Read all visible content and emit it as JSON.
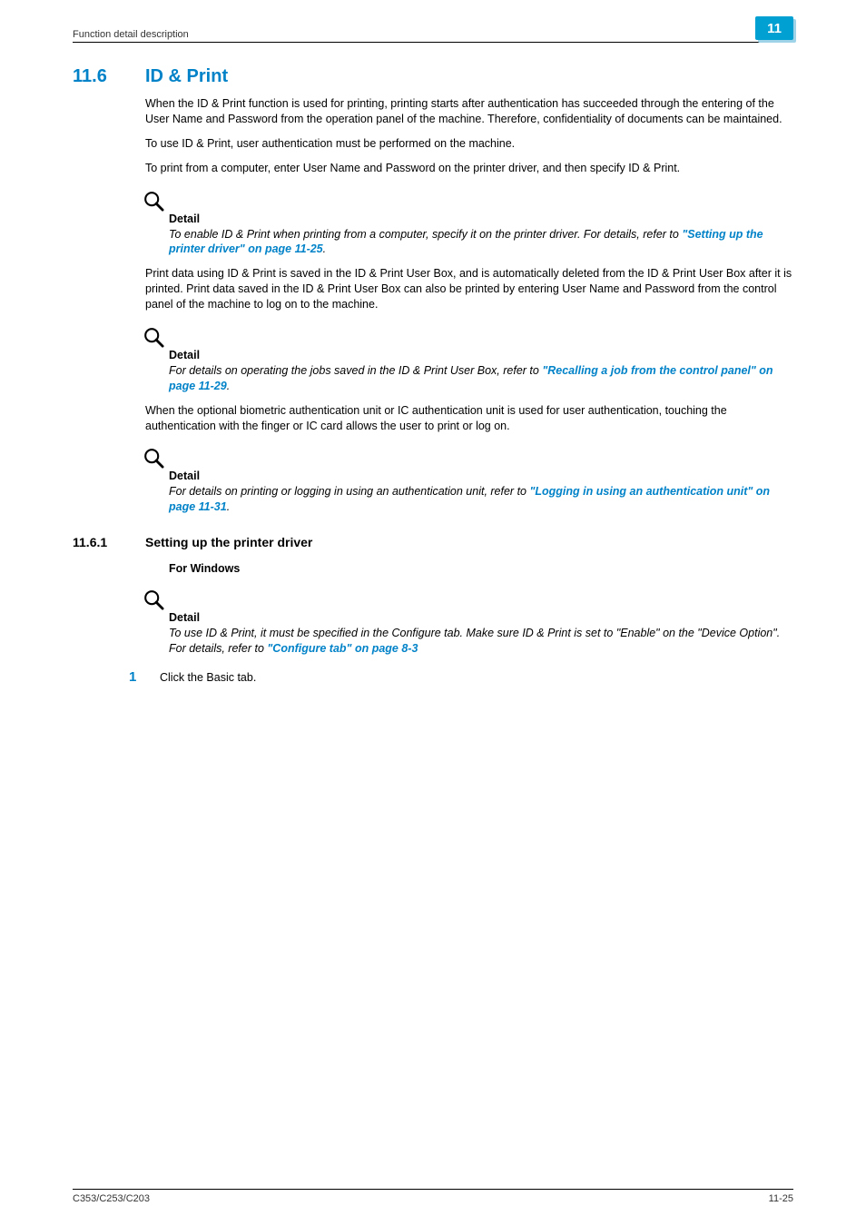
{
  "header": {
    "breadcrumb": "Function detail description",
    "chapter_badge": "11"
  },
  "section": {
    "number": "11.6",
    "title": "ID & Print"
  },
  "body": {
    "p1": "When the ID & Print function is used for printing, printing starts after authentication has succeeded through the entering of the User Name and Password from the operation panel of the machine. Therefore, confidentiality of documents can be maintained.",
    "p2": "To use ID & Print, user authentication must be performed on the machine.",
    "p3": "To print from a computer, enter User Name and Password on the printer driver, and then specify ID & Print."
  },
  "detail1": {
    "label": "Detail",
    "text_before": "To enable ID & Print when printing from a computer, specify it on the printer driver. For details, refer to ",
    "link": "\"Setting up the printer driver\" on page 11-25",
    "text_after": "."
  },
  "body2": {
    "p4": "Print data using ID & Print is saved in the ID & Print User Box, and is automatically deleted from the ID & Print User Box after it is printed. Print data saved in the ID & Print User Box can also be printed by entering User Name and Password from the control panel of the machine to log on to the machine."
  },
  "detail2": {
    "label": "Detail",
    "text_before": "For details on operating the jobs saved in the ID & Print User Box, refer to ",
    "link": "\"Recalling a job from the control panel\" on page 11-29",
    "text_after": "."
  },
  "body3": {
    "p5": "When the optional biometric authentication unit or IC authentication unit is used for user authentication, touching the authentication with the finger or IC card allows the user to print or log on."
  },
  "detail3": {
    "label": "Detail",
    "text_before": "For details on printing or logging in using an authentication unit, refer to ",
    "link": "\"Logging in using an authentication unit\" on page 11-31",
    "text_after": "."
  },
  "subsection": {
    "number": "11.6.1",
    "title": "Setting up the printer driver",
    "sub_heading": "For Windows"
  },
  "detail4": {
    "label": "Detail",
    "text_before": "To use ID & Print, it must be specified in the Configure tab. Make sure ID & Print is set to \"Enable\" on the \"Device Option\". For details, refer to ",
    "link": "\"Configure tab\" on page 8-3",
    "text_after": ""
  },
  "step": {
    "number": "1",
    "text": "Click the Basic tab."
  },
  "footer": {
    "left": "C353/C253/C203",
    "right": "11-25"
  }
}
